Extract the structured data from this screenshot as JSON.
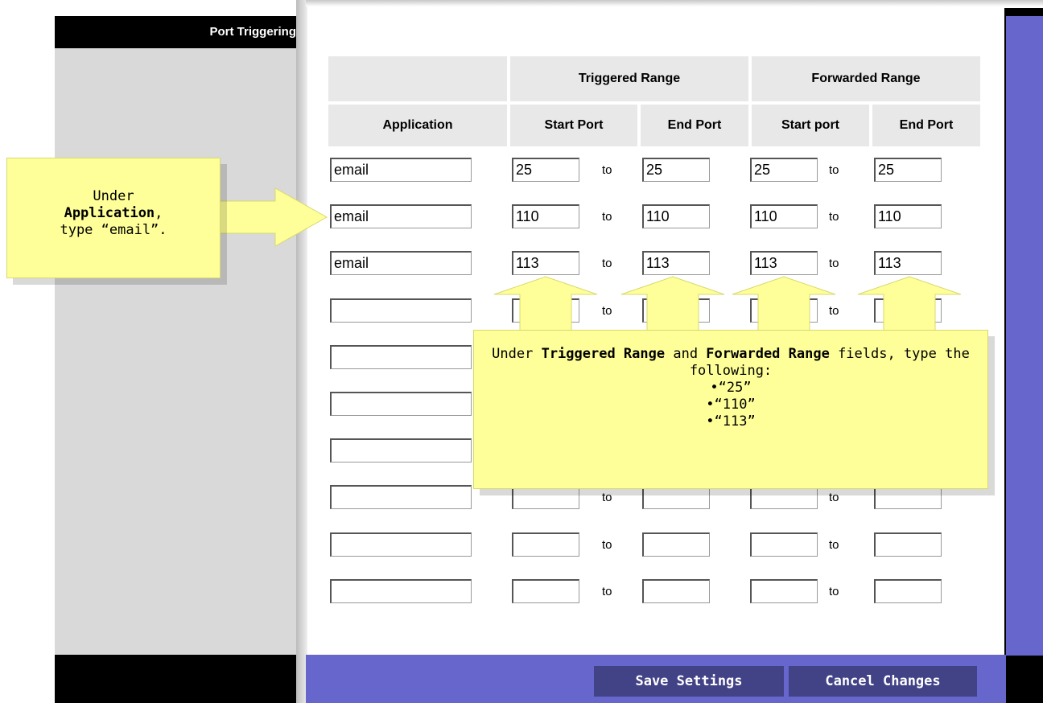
{
  "sidebar": {
    "section_title": "Port Triggering"
  },
  "table": {
    "group_headers": {
      "triggered": "Triggered Range",
      "forwarded": "Forwarded Range"
    },
    "columns": {
      "application": "Application",
      "triggered_start": "Start Port",
      "triggered_end": "End Port",
      "forwarded_start": "Start port",
      "forwarded_end": "End Port"
    },
    "separator": "to",
    "rows": [
      {
        "app": "email",
        "t_start": "25",
        "t_end": "25",
        "f_start": "25",
        "f_end": "25"
      },
      {
        "app": "email",
        "t_start": "110",
        "t_end": "110",
        "f_start": "110",
        "f_end": "110"
      },
      {
        "app": "email",
        "t_start": "113",
        "t_end": "113",
        "f_start": "113",
        "f_end": "113"
      },
      {
        "app": "",
        "t_start": "",
        "t_end": "",
        "f_start": "",
        "f_end": ""
      },
      {
        "app": "",
        "t_start": "",
        "t_end": "",
        "f_start": "",
        "f_end": ""
      },
      {
        "app": "",
        "t_start": "",
        "t_end": "",
        "f_start": "",
        "f_end": ""
      },
      {
        "app": "",
        "t_start": "",
        "t_end": "",
        "f_start": "",
        "f_end": ""
      },
      {
        "app": "",
        "t_start": "",
        "t_end": "",
        "f_start": "",
        "f_end": ""
      },
      {
        "app": "",
        "t_start": "",
        "t_end": "",
        "f_start": "",
        "f_end": ""
      },
      {
        "app": "",
        "t_start": "",
        "t_end": "",
        "f_start": "",
        "f_end": ""
      }
    ]
  },
  "callouts": {
    "application": {
      "line1": "Under",
      "line2_bold": "Application",
      "line2_rest": ",",
      "line3": "type “email”."
    },
    "ports": {
      "intro": "Under ",
      "bold1": "Triggered Range",
      "mid": " and ",
      "bold2": "Forwarded Range",
      "rest": " fields, type the following:",
      "bullets": [
        "•“25”",
        "•“110”",
        "•“113”"
      ]
    }
  },
  "buttons": {
    "save": "Save Settings",
    "cancel": "Cancel Changes"
  },
  "colors": {
    "accent_purple": "#6666cc",
    "button_purple": "#424287",
    "callout_yellow": "#ffff99",
    "header_gray": "#e8e8e8"
  }
}
